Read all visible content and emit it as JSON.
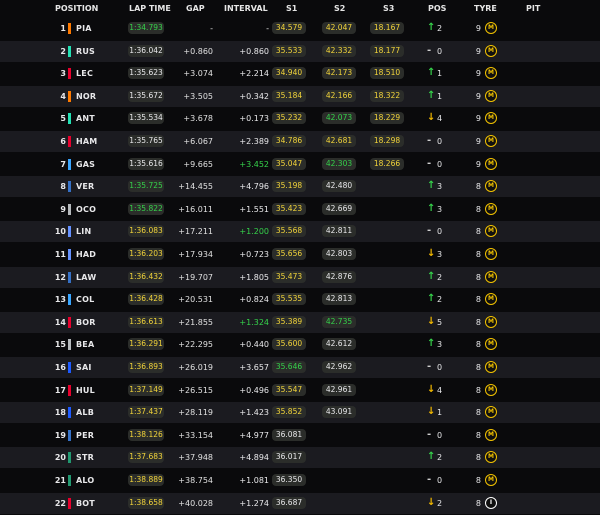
{
  "headers": {
    "position": "POSITION",
    "lap_time": "LAP TIME",
    "gap": "GAP",
    "interval": "INTERVAL",
    "s1": "S1",
    "s2": "S2",
    "s3": "S3",
    "pos": "POS",
    "tyre": "TYRE",
    "pit": "PIT"
  },
  "colors": {
    "purple": "#b3b3b3",
    "green": "#35d04a",
    "yellow": "#f2d43a",
    "white": "#e8e8ea",
    "up_arrow": "#35d04a",
    "down_arrow": "#f2b800",
    "same": "#cfcfcf"
  },
  "drivers": [
    {
      "pos": "1",
      "code": "PIA",
      "team_color": "#ff7a00",
      "lap": "1:34.793",
      "lap_color": "green",
      "gap": "-",
      "interval": "-",
      "interval_color": "white",
      "s1": "34.579",
      "s1_color": "yellow",
      "s2": "42.047",
      "s2_color": "yellow",
      "s3": "18.167",
      "s3_color": "yellow",
      "pos_change": "up",
      "pos_delta": "2",
      "tyre_laps": "9",
      "tyre": "M"
    },
    {
      "pos": "2",
      "code": "RUS",
      "team_color": "#24e2b4",
      "lap": "1:36.042",
      "lap_color": "white",
      "gap": "+0.860",
      "interval": "+0.860",
      "interval_color": "white",
      "s1": "35.533",
      "s1_color": "yellow",
      "s2": "42.332",
      "s2_color": "yellow",
      "s3": "18.177",
      "s3_color": "yellow",
      "pos_change": "same",
      "pos_delta": "0",
      "tyre_laps": "9",
      "tyre": "M"
    },
    {
      "pos": "3",
      "code": "LEC",
      "team_color": "#e8002d",
      "lap": "1:35.623",
      "lap_color": "white",
      "gap": "+3.074",
      "interval": "+2.214",
      "interval_color": "white",
      "s1": "34.940",
      "s1_color": "yellow",
      "s2": "42.173",
      "s2_color": "yellow",
      "s3": "18.510",
      "s3_color": "yellow",
      "pos_change": "up",
      "pos_delta": "1",
      "tyre_laps": "9",
      "tyre": "M"
    },
    {
      "pos": "4",
      "code": "NOR",
      "team_color": "#ff7a00",
      "lap": "1:35.672",
      "lap_color": "white",
      "gap": "+3.505",
      "interval": "+0.342",
      "interval_color": "white",
      "s1": "35.184",
      "s1_color": "yellow",
      "s2": "42.166",
      "s2_color": "yellow",
      "s3": "18.322",
      "s3_color": "yellow",
      "pos_change": "up",
      "pos_delta": "1",
      "tyre_laps": "9",
      "tyre": "M"
    },
    {
      "pos": "5",
      "code": "ANT",
      "team_color": "#24e2b4",
      "lap": "1:35.534",
      "lap_color": "white",
      "gap": "+3.678",
      "interval": "+0.173",
      "interval_color": "white",
      "s1": "35.232",
      "s1_color": "yellow",
      "s2": "42.073",
      "s2_color": "green",
      "s3": "18.229",
      "s3_color": "yellow",
      "pos_change": "down",
      "pos_delta": "4",
      "tyre_laps": "9",
      "tyre": "M"
    },
    {
      "pos": "6",
      "code": "HAM",
      "team_color": "#e8002d",
      "lap": "1:35.765",
      "lap_color": "white",
      "gap": "+6.067",
      "interval": "+2.389",
      "interval_color": "white",
      "s1": "34.786",
      "s1_color": "yellow",
      "s2": "42.681",
      "s2_color": "yellow",
      "s3": "18.298",
      "s3_color": "yellow",
      "pos_change": "same",
      "pos_delta": "0",
      "tyre_laps": "9",
      "tyre": "M"
    },
    {
      "pos": "7",
      "code": "GAS",
      "team_color": "#3aa6ff",
      "lap": "1:35.616",
      "lap_color": "white",
      "gap": "+9.665",
      "interval": "+3.452",
      "interval_color": "green",
      "s1": "35.047",
      "s1_color": "yellow",
      "s2": "42.303",
      "s2_color": "green",
      "s3": "18.266",
      "s3_color": "yellow",
      "pos_change": "same",
      "pos_delta": "0",
      "tyre_laps": "9",
      "tyre": "M"
    },
    {
      "pos": "8",
      "code": "VER",
      "team_color": "#3671c6",
      "lap": "1:35.725",
      "lap_color": "green",
      "gap": "+14.455",
      "interval": "+4.796",
      "interval_color": "white",
      "s1": "35.198",
      "s1_color": "yellow",
      "s2": "42.480",
      "s2_color": "white",
      "s3": "",
      "s3_color": "white",
      "pos_change": "up",
      "pos_delta": "3",
      "tyre_laps": "8",
      "tyre": "M"
    },
    {
      "pos": "9",
      "code": "OCO",
      "team_color": "#b6babd",
      "lap": "1:35.822",
      "lap_color": "green",
      "gap": "+16.011",
      "interval": "+1.551",
      "interval_color": "white",
      "s1": "35.423",
      "s1_color": "yellow",
      "s2": "42.669",
      "s2_color": "white",
      "s3": "",
      "s3_color": "white",
      "pos_change": "up",
      "pos_delta": "3",
      "tyre_laps": "8",
      "tyre": "M"
    },
    {
      "pos": "10",
      "code": "LIN",
      "team_color": "#6692ff",
      "lap": "1:36.083",
      "lap_color": "yellow",
      "gap": "+17.211",
      "interval": "+1.200",
      "interval_color": "green",
      "s1": "35.568",
      "s1_color": "yellow",
      "s2": "42.811",
      "s2_color": "white",
      "s3": "",
      "s3_color": "white",
      "pos_change": "same",
      "pos_delta": "0",
      "tyre_laps": "8",
      "tyre": "M"
    },
    {
      "pos": "11",
      "code": "HAD",
      "team_color": "#6692ff",
      "lap": "1:36.203",
      "lap_color": "yellow",
      "gap": "+17.934",
      "interval": "+0.723",
      "interval_color": "white",
      "s1": "35.656",
      "s1_color": "yellow",
      "s2": "42.803",
      "s2_color": "white",
      "s3": "",
      "s3_color": "white",
      "pos_change": "down",
      "pos_delta": "3",
      "tyre_laps": "8",
      "tyre": "M"
    },
    {
      "pos": "12",
      "code": "LAW",
      "team_color": "#3671c6",
      "lap": "1:36.432",
      "lap_color": "yellow",
      "gap": "+19.707",
      "interval": "+1.805",
      "interval_color": "white",
      "s1": "35.473",
      "s1_color": "yellow",
      "s2": "42.876",
      "s2_color": "white",
      "s3": "",
      "s3_color": "white",
      "pos_change": "up",
      "pos_delta": "2",
      "tyre_laps": "8",
      "tyre": "M"
    },
    {
      "pos": "13",
      "code": "COL",
      "team_color": "#3aa6ff",
      "lap": "1:36.428",
      "lap_color": "yellow",
      "gap": "+20.531",
      "interval": "+0.824",
      "interval_color": "white",
      "s1": "35.535",
      "s1_color": "yellow",
      "s2": "42.813",
      "s2_color": "white",
      "s3": "",
      "s3_color": "white",
      "pos_change": "up",
      "pos_delta": "2",
      "tyre_laps": "8",
      "tyre": "M"
    },
    {
      "pos": "14",
      "code": "BOR",
      "team_color": "#e8002d",
      "lap": "1:36.613",
      "lap_color": "yellow",
      "gap": "+21.855",
      "interval": "+1.324",
      "interval_color": "green",
      "s1": "35.389",
      "s1_color": "yellow",
      "s2": "42.735",
      "s2_color": "green",
      "s3": "",
      "s3_color": "white",
      "pos_change": "down",
      "pos_delta": "5",
      "tyre_laps": "8",
      "tyre": "M"
    },
    {
      "pos": "15",
      "code": "BEA",
      "team_color": "#b6babd",
      "lap": "1:36.291",
      "lap_color": "yellow",
      "gap": "+22.295",
      "interval": "+0.440",
      "interval_color": "white",
      "s1": "35.600",
      "s1_color": "yellow",
      "s2": "42.612",
      "s2_color": "white",
      "s3": "",
      "s3_color": "white",
      "pos_change": "up",
      "pos_delta": "3",
      "tyre_laps": "8",
      "tyre": "M"
    },
    {
      "pos": "16",
      "code": "SAI",
      "team_color": "#1e5bff",
      "lap": "1:36.893",
      "lap_color": "yellow",
      "gap": "+26.019",
      "interval": "+3.657",
      "interval_color": "white",
      "s1": "35.646",
      "s1_color": "green",
      "s2": "42.962",
      "s2_color": "white",
      "s3": "",
      "s3_color": "white",
      "pos_change": "same",
      "pos_delta": "0",
      "tyre_laps": "8",
      "tyre": "M"
    },
    {
      "pos": "17",
      "code": "HUL",
      "team_color": "#e8002d",
      "lap": "1:37.149",
      "lap_color": "yellow",
      "gap": "+26.515",
      "interval": "+0.496",
      "interval_color": "white",
      "s1": "35.547",
      "s1_color": "yellow",
      "s2": "42.961",
      "s2_color": "white",
      "s3": "",
      "s3_color": "white",
      "pos_change": "down",
      "pos_delta": "4",
      "tyre_laps": "8",
      "tyre": "M"
    },
    {
      "pos": "18",
      "code": "ALB",
      "team_color": "#1e5bff",
      "lap": "1:37.437",
      "lap_color": "yellow",
      "gap": "+28.119",
      "interval": "+1.423",
      "interval_color": "white",
      "s1": "35.852",
      "s1_color": "yellow",
      "s2": "43.091",
      "s2_color": "white",
      "s3": "",
      "s3_color": "white",
      "pos_change": "down",
      "pos_delta": "1",
      "tyre_laps": "8",
      "tyre": "M"
    },
    {
      "pos": "19",
      "code": "PER",
      "team_color": "#3671c6",
      "lap": "1:38.126",
      "lap_color": "yellow",
      "gap": "+33.154",
      "interval": "+4.977",
      "interval_color": "white",
      "s1": "36.081",
      "s1_color": "white",
      "s2": "",
      "s2_color": "white",
      "s3": "",
      "s3_color": "white",
      "pos_change": "same",
      "pos_delta": "0",
      "tyre_laps": "8",
      "tyre": "M"
    },
    {
      "pos": "20",
      "code": "STR",
      "team_color": "#229971",
      "lap": "1:37.683",
      "lap_color": "yellow",
      "gap": "+37.948",
      "interval": "+4.894",
      "interval_color": "white",
      "s1": "36.017",
      "s1_color": "white",
      "s2": "",
      "s2_color": "white",
      "s3": "",
      "s3_color": "white",
      "pos_change": "up",
      "pos_delta": "2",
      "tyre_laps": "8",
      "tyre": "M"
    },
    {
      "pos": "21",
      "code": "ALO",
      "team_color": "#229971",
      "lap": "1:38.889",
      "lap_color": "yellow",
      "gap": "+38.754",
      "interval": "+1.081",
      "interval_color": "white",
      "s1": "36.350",
      "s1_color": "white",
      "s2": "",
      "s2_color": "white",
      "s3": "",
      "s3_color": "white",
      "pos_change": "same",
      "pos_delta": "0",
      "tyre_laps": "8",
      "tyre": "M"
    },
    {
      "pos": "22",
      "code": "BOT",
      "team_color": "#e8002d",
      "lap": "1:38.658",
      "lap_color": "yellow",
      "gap": "+40.028",
      "interval": "+1.274",
      "interval_color": "white",
      "s1": "36.687",
      "s1_color": "white",
      "s2": "",
      "s2_color": "white",
      "s3": "",
      "s3_color": "white",
      "pos_change": "down",
      "pos_delta": "2",
      "tyre_laps": "8",
      "tyre": "I"
    }
  ]
}
